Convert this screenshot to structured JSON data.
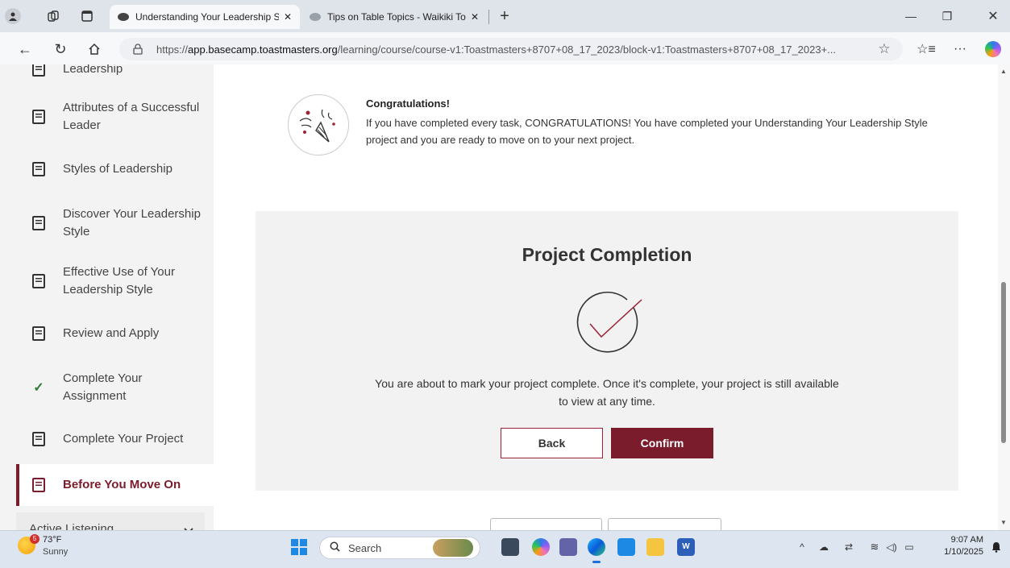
{
  "browser": {
    "tabs": [
      {
        "title": "Understanding Your Leadership St",
        "active": true
      },
      {
        "title": "Tips on Table Topics - Waikiki Toa",
        "active": false
      }
    ],
    "new_tab": "+",
    "url_prefix": "https://",
    "url_host": "app.basecamp.toastmasters.org",
    "url_path": "/learning/course/course-v1:Toastmasters+8707+08_17_2023/block-v1:Toastmasters+8707+08_17_2023+...",
    "window_controls": {
      "minimize": "—",
      "restore": "❐",
      "close": "✕"
    }
  },
  "sidebar": {
    "items": [
      {
        "label": "Leadership",
        "icon": "document-icon",
        "selected": false
      },
      {
        "label": "Attributes of a Successful Leader",
        "icon": "document-icon",
        "selected": false
      },
      {
        "label": "Styles of Leadership",
        "icon": "document-icon",
        "selected": false
      },
      {
        "label": "Discover Your Leadership Style",
        "icon": "document-icon",
        "selected": false
      },
      {
        "label": "Effective Use of Your Leadership Style",
        "icon": "document-icon",
        "selected": false
      },
      {
        "label": "Review and Apply",
        "icon": "document-icon",
        "selected": false
      },
      {
        "label": "Complete Your Assignment",
        "icon": "check-icon",
        "selected": false
      },
      {
        "label": "Complete Your Project",
        "icon": "document-icon",
        "selected": false
      },
      {
        "label": "Before You Move On",
        "icon": "document-icon",
        "selected": true
      }
    ],
    "section": {
      "label": "Active Listening",
      "icon": "chevron-down-icon"
    }
  },
  "main": {
    "congrats": {
      "title": "Congratulations!",
      "body": "If you have completed every task, CONGRATULATIONS! You have completed your Understanding Your Leadership Style project and you are ready to move on to your next project."
    },
    "completion": {
      "title": "Project Completion",
      "message": "You are about to mark your project complete. Once it's complete, your project is still available to view at any time.",
      "back_label": "Back",
      "confirm_label": "Confirm"
    }
  },
  "taskbar": {
    "weather": {
      "temp": "73°F",
      "condition": "Sunny",
      "badge": "5"
    },
    "search_placeholder": "Search",
    "time": "9:07 AM",
    "date": "1/10/2025"
  },
  "colors": {
    "accent": "#7b1c2c",
    "success": "#2e7d32"
  }
}
